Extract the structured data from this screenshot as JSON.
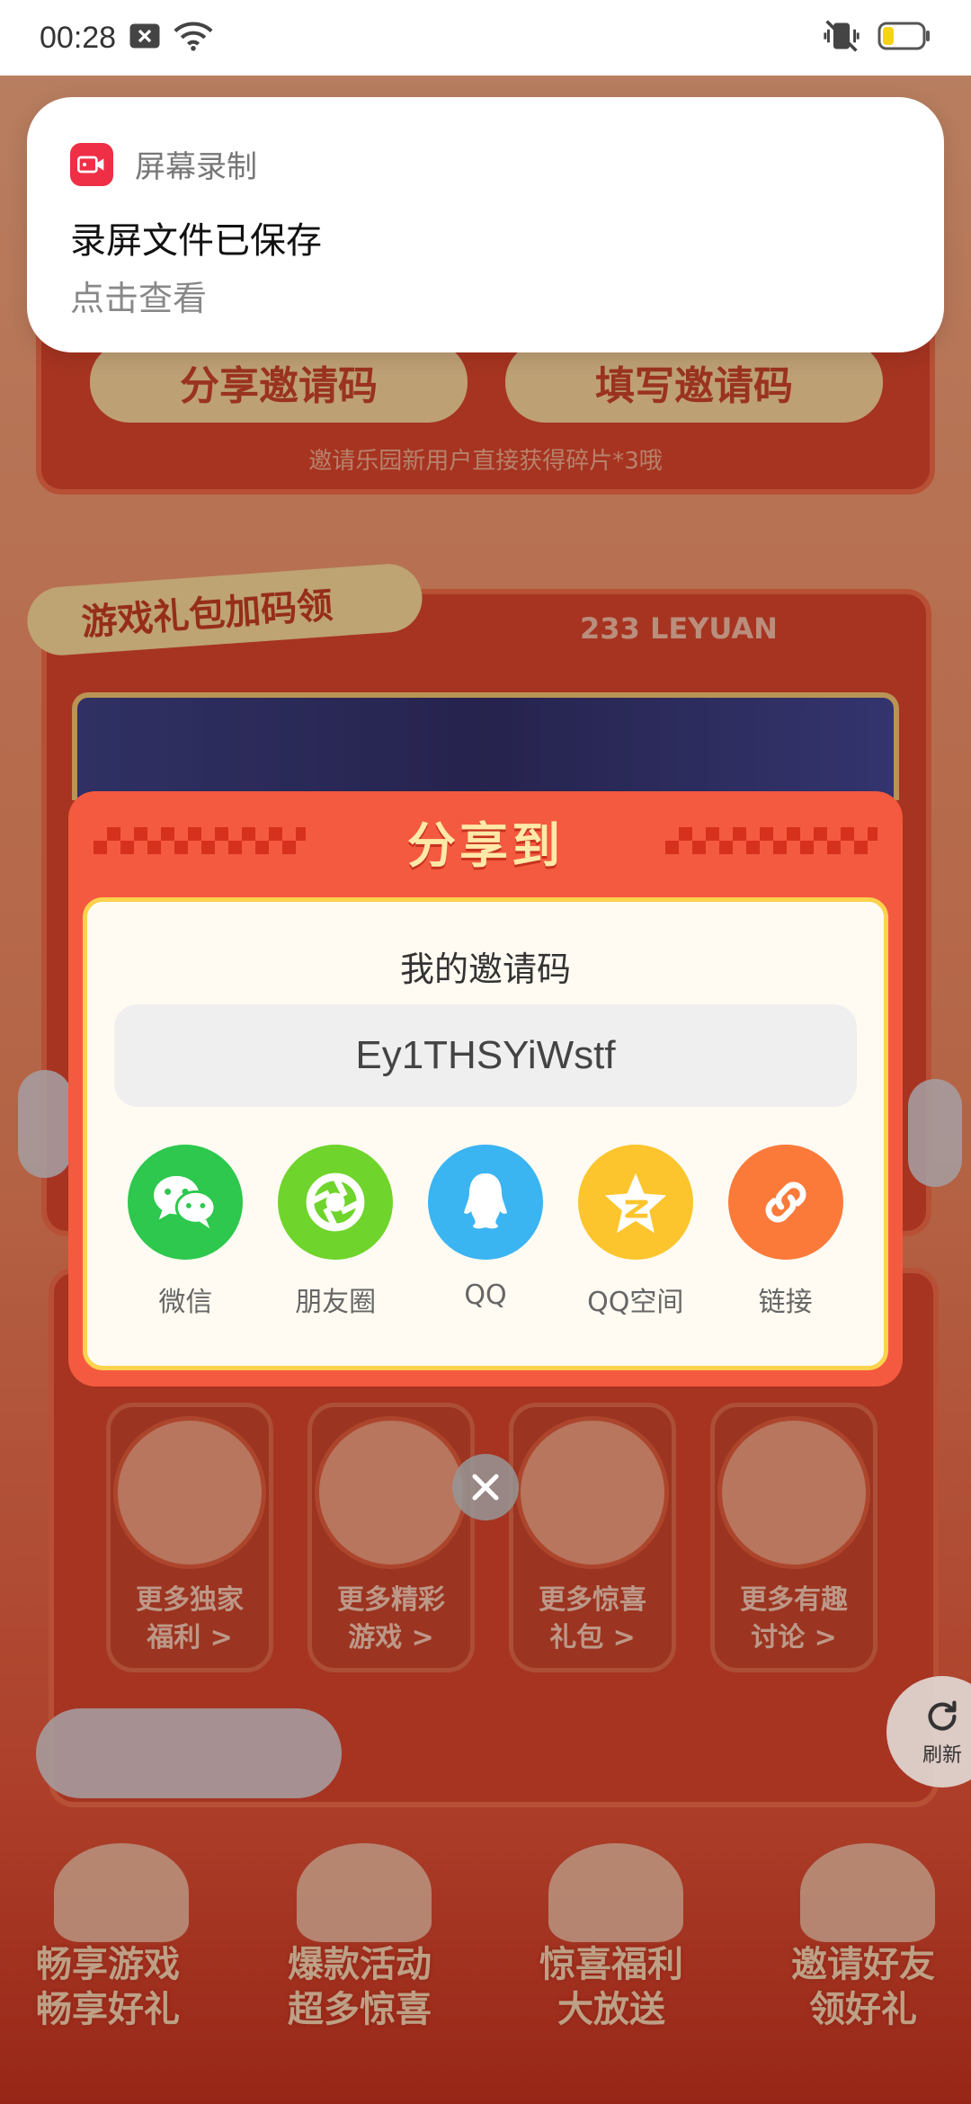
{
  "status_bar": {
    "time": "00:28"
  },
  "notification": {
    "app_name": "屏幕录制",
    "title": "录屏文件已保存",
    "subtitle": "点击查看"
  },
  "background": {
    "share_code_button": "分享邀请码",
    "fill_code_button": "填写邀请码",
    "invite_tip": "邀请乐园新用户直接获得碎片*3哦",
    "gift_ribbon": "游戏礼包加码领",
    "brand_text": "233 LEYUAN",
    "tiles": [
      {
        "line1": "更多独家",
        "line2": "福利 >"
      },
      {
        "line1": "更多精彩",
        "line2": "游戏 >"
      },
      {
        "line1": "更多惊喜",
        "line2": "礼包 >"
      },
      {
        "line1": "更多有趣",
        "line2": "讨论 >"
      }
    ],
    "bottom_labels": [
      {
        "line1": "畅享游戏",
        "line2": "畅享好礼"
      },
      {
        "line1": "爆款活动",
        "line2": "超多惊喜"
      },
      {
        "line1": "惊喜福利",
        "line2": "大放送"
      },
      {
        "line1": "邀请好友",
        "line2": "领好礼"
      }
    ]
  },
  "dialog": {
    "title": "分享到",
    "invite_label": "我的邀请码",
    "invite_code": "Ey1THSYiWstf",
    "share_targets": [
      {
        "label": "微信",
        "icon": "wechat-icon",
        "color": "#2dc84d"
      },
      {
        "label": "朋友圈",
        "icon": "moments-icon",
        "color": "#6fd42b"
      },
      {
        "label": "QQ",
        "icon": "qq-icon",
        "color": "#3bb4f2"
      },
      {
        "label": "QQ空间",
        "icon": "qzone-icon",
        "color": "#fcc52d"
      },
      {
        "label": "链接",
        "icon": "link-icon",
        "color": "#fb7a3a"
      }
    ]
  },
  "refresh": {
    "label": "刷新"
  }
}
